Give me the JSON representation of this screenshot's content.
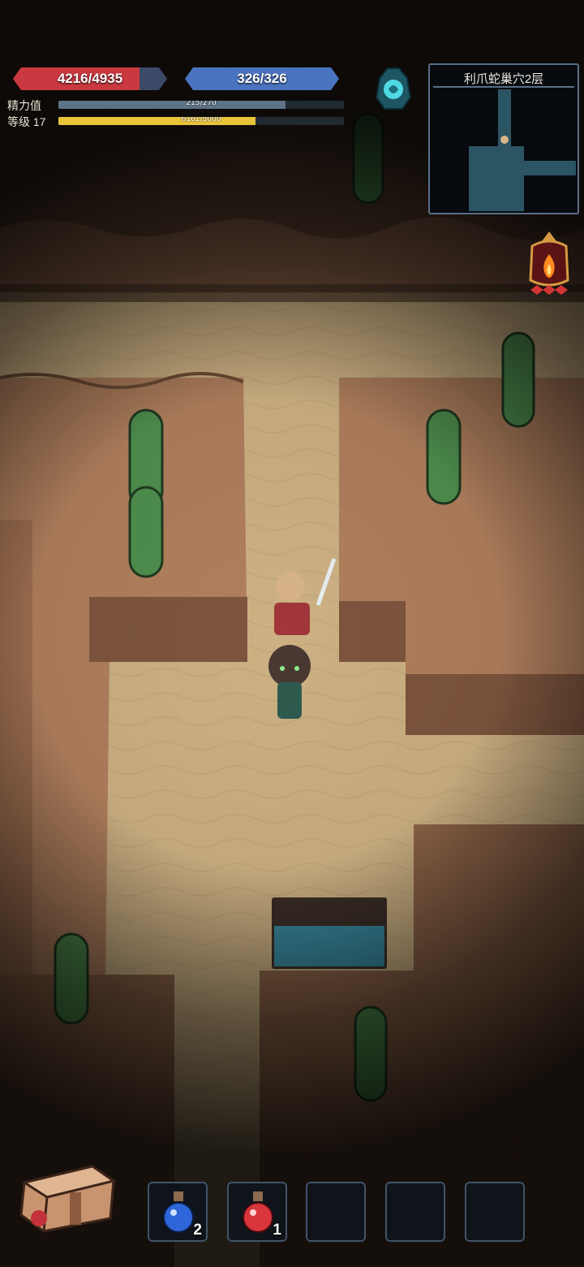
{
  "hud": {
    "hp": {
      "text": "4216/4935",
      "current": 4216,
      "max": 4935,
      "color": "#c9393f"
    },
    "mp": {
      "text": "326/326",
      "current": 326,
      "max": 326,
      "color": "#4a74bf"
    },
    "stamina": {
      "label": "精力值",
      "text": "215/270",
      "current": 215,
      "max": 270,
      "color": "#5e7387"
    },
    "level": {
      "label": "等级 17",
      "text": "6161/5000",
      "fill": 0.69,
      "color": "#e9c43a"
    }
  },
  "minimap": {
    "title": "利爪蛇巢穴2层"
  },
  "inventory": {
    "slots": [
      {
        "item": "blue-potion",
        "count": "2"
      },
      {
        "item": "red-potion",
        "count": "1"
      },
      {
        "item": "",
        "count": ""
      },
      {
        "item": "",
        "count": ""
      },
      {
        "item": "",
        "count": ""
      }
    ]
  },
  "icons": {
    "portal": "portal-stone-icon",
    "fire": "fire-lantern-icon",
    "bag": "backpack-icon"
  }
}
